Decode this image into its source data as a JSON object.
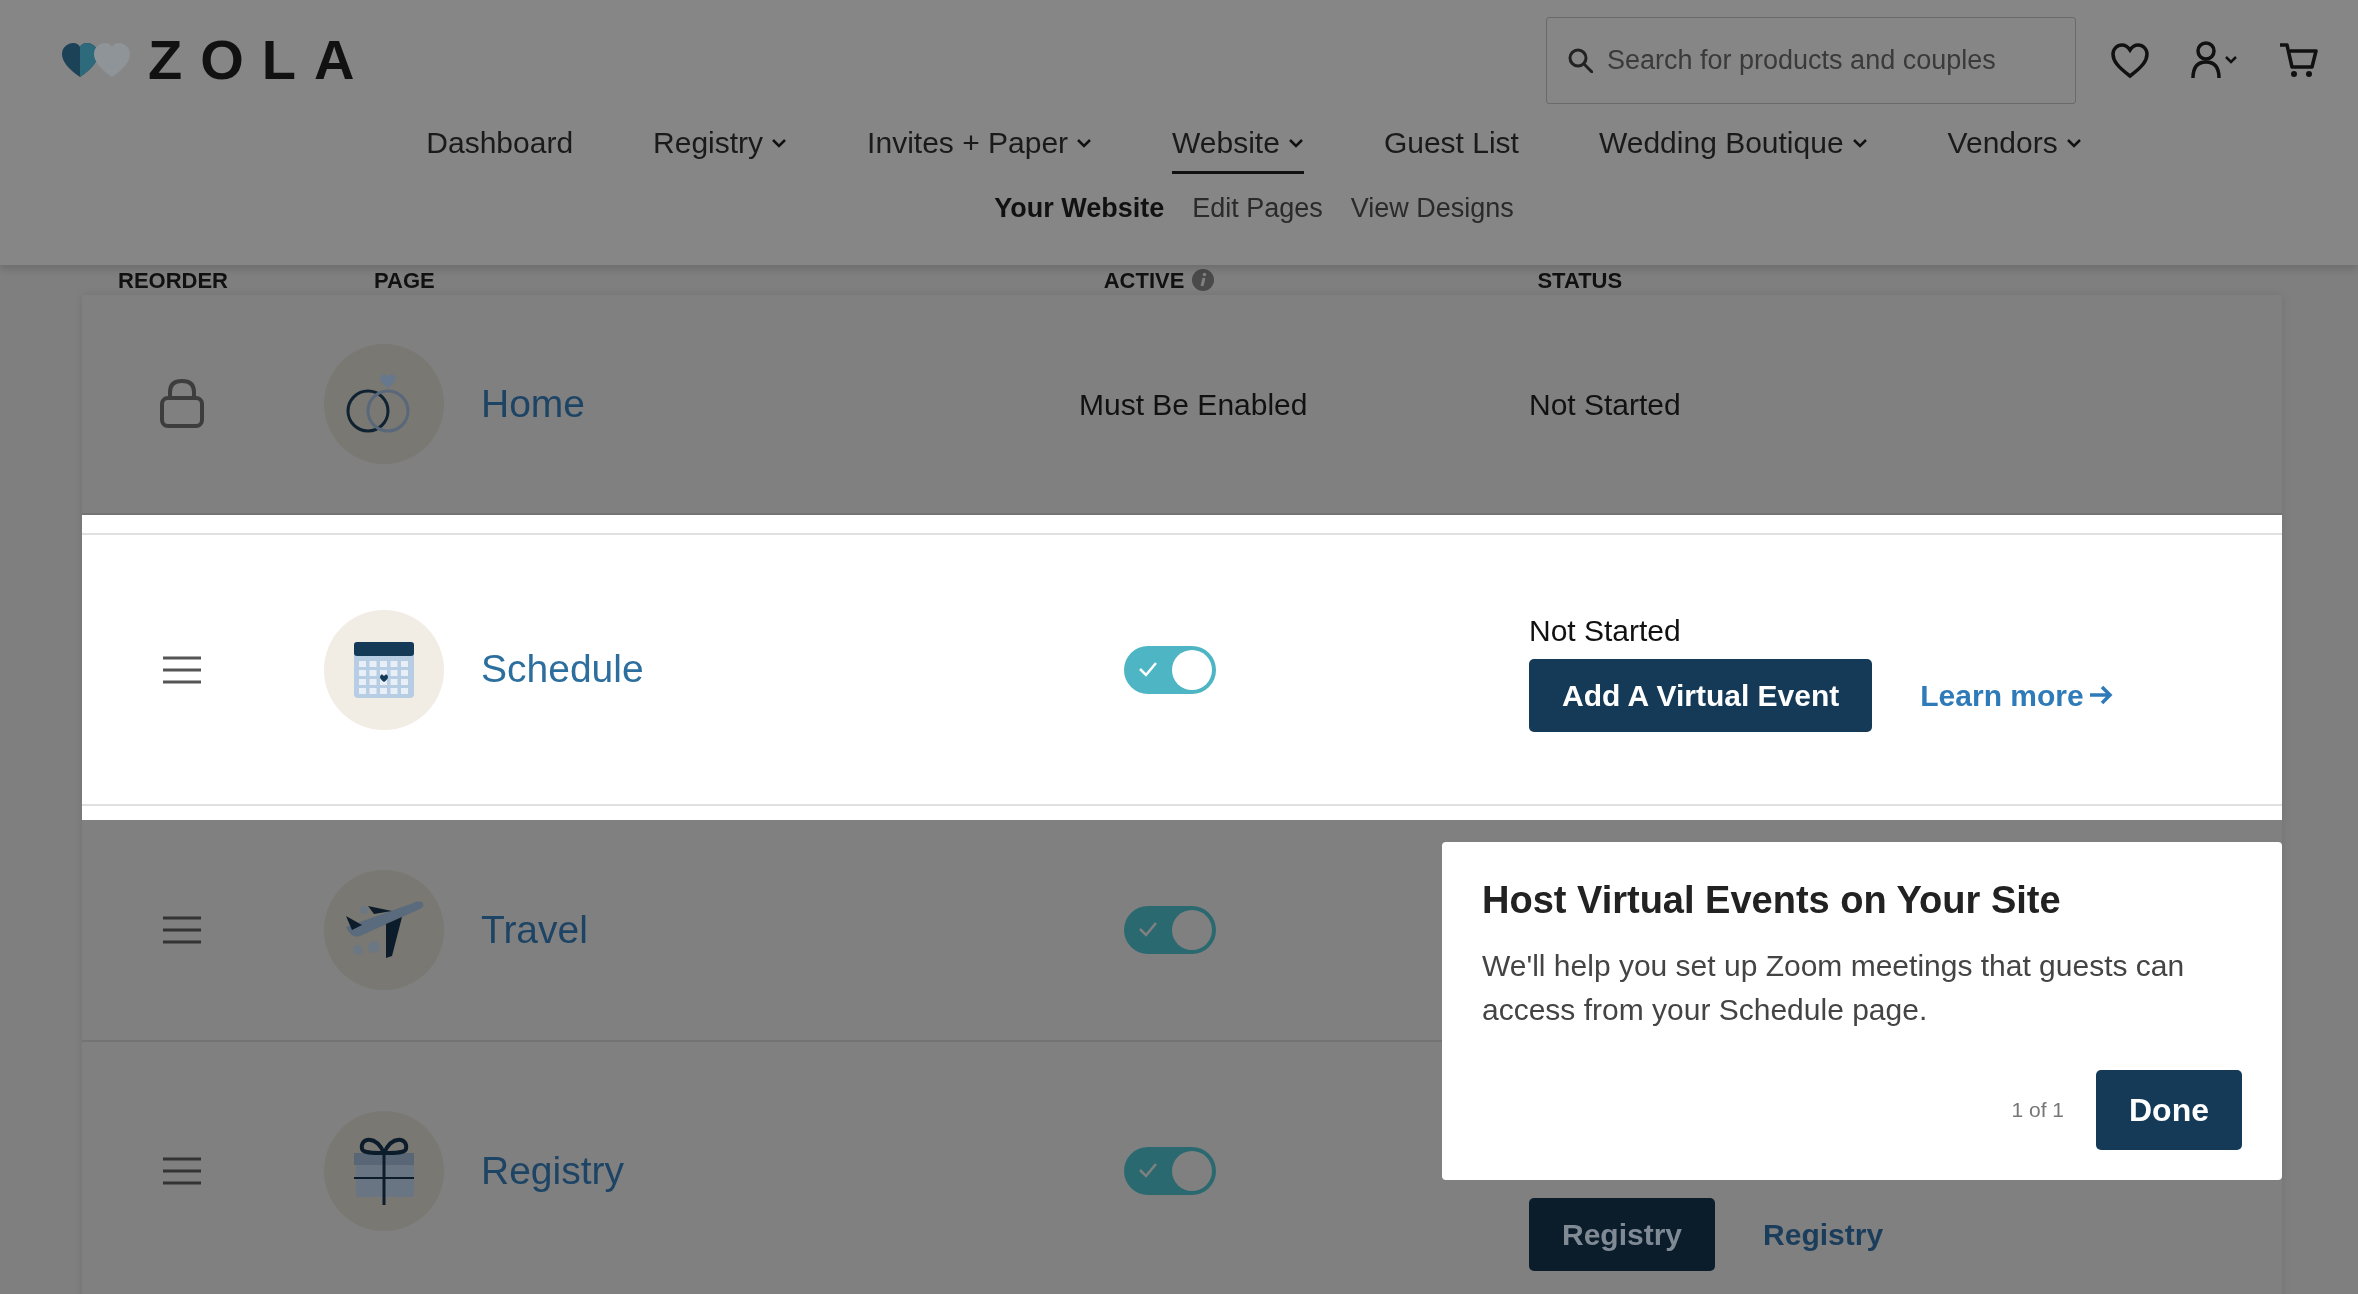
{
  "logo": {
    "text": "ZOLA"
  },
  "search": {
    "placeholder": "Search for products and couples"
  },
  "nav": [
    {
      "label": "Dashboard",
      "dropdown": false,
      "selected": false
    },
    {
      "label": "Registry",
      "dropdown": true,
      "selected": false
    },
    {
      "label": "Invites + Paper",
      "dropdown": true,
      "selected": false
    },
    {
      "label": "Website",
      "dropdown": true,
      "selected": true
    },
    {
      "label": "Guest List",
      "dropdown": false,
      "selected": false
    },
    {
      "label": "Wedding Boutique",
      "dropdown": true,
      "selected": false
    },
    {
      "label": "Vendors",
      "dropdown": true,
      "selected": false
    }
  ],
  "subnav": [
    {
      "label": "Your Website",
      "selected": true
    },
    {
      "label": "Edit Pages",
      "selected": false
    },
    {
      "label": "View Designs",
      "selected": false
    }
  ],
  "table": {
    "columns": [
      "REORDER",
      "PAGE",
      "ACTIVE",
      "STATUS"
    ],
    "rows": [
      {
        "name": "Home",
        "locked": true,
        "highlighted": false,
        "active": {
          "kind": "text",
          "text": "Must Be Enabled"
        },
        "status": "Not Started"
      },
      {
        "name": "Schedule",
        "locked": false,
        "highlighted": true,
        "active": {
          "kind": "toggle",
          "on": true
        },
        "status": "Not Started",
        "action_button": "Add A Virtual Event",
        "action_link": "Learn more"
      },
      {
        "name": "Travel",
        "locked": false,
        "highlighted": false,
        "active": {
          "kind": "toggle",
          "on": true
        }
      },
      {
        "name": "Registry",
        "locked": false,
        "highlighted": false,
        "active": {
          "kind": "toggle",
          "on": true
        },
        "action_button": "Registry",
        "action_link": "Registry"
      }
    ]
  },
  "popover": {
    "title": "Host Virtual Events on Your Site",
    "body": "We'll help you set up Zoom meetings that guests can access from your Schedule page.",
    "counter": "1 of 1",
    "button": "Done"
  }
}
